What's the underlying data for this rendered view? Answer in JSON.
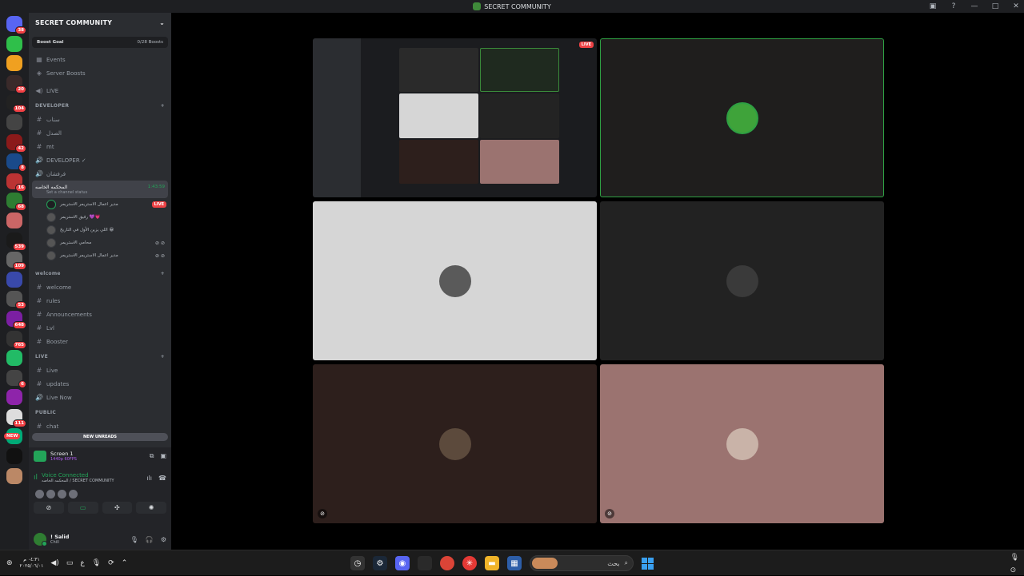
{
  "window": {
    "title": "SECRET COMMUNITY"
  },
  "servers": {
    "badges": [
      "38",
      "",
      "",
      "20",
      "104",
      "",
      "42",
      "8",
      "16",
      "68",
      "",
      "539",
      "109",
      "",
      "53",
      "648",
      "765",
      "",
      "6",
      "",
      "111",
      "",
      "",
      ""
    ],
    "new_label": "NEW"
  },
  "guild": {
    "name": "SECRET COMMUNITY",
    "boost_label": "Boost Goal",
    "boost_count": "0/28 Boosts",
    "events": "Events",
    "server_boosts": "Server Boosts",
    "live": "LIVE"
  },
  "categories": {
    "developer": "DEVELOPER",
    "welcome": "welcome",
    "live": "LIVE",
    "public": "PUBLIC"
  },
  "channels_dev": [
    {
      "icon": "#",
      "label": "سناب"
    },
    {
      "icon": "#",
      "label": "الصدل"
    },
    {
      "icon": "#",
      "label": "mt"
    },
    {
      "icon": "🔊",
      "label": "DEVELOPER ✓"
    },
    {
      "icon": "🔊",
      "label": "فرفشان"
    }
  ],
  "active_voice": {
    "label": "المحكمه الخاصه",
    "timer": "1:43:59",
    "status": "Set a channel status"
  },
  "voice_users": [
    {
      "name": "مدير اعمال الاستريمر الاستريمر",
      "live": "LIVE"
    },
    {
      "name": "رفيق الاستريمر 💜💗",
      "live": ""
    },
    {
      "name": "اللي يزين الأول في التاريخ 😁",
      "live": ""
    },
    {
      "name": "محامي الاستريمر",
      "live": ""
    },
    {
      "name": "مدير اعمال الاستريمر الاستريمر",
      "live": ""
    }
  ],
  "channels_welcome": [
    {
      "icon": "#",
      "label": "welcome"
    },
    {
      "icon": "#",
      "label": "rules"
    },
    {
      "icon": "#",
      "label": "Announcements"
    },
    {
      "icon": "#",
      "label": "Lvl"
    },
    {
      "icon": "#",
      "label": "Booster"
    }
  ],
  "channels_live": [
    {
      "icon": "#",
      "label": "Live"
    },
    {
      "icon": "#",
      "label": "updates"
    },
    {
      "icon": "🔊",
      "label": "Live Now"
    }
  ],
  "last_channel": "chat",
  "new_unreads": "NEW UNREADS",
  "panel": {
    "screen_title": "Screen 1",
    "screen_quality": "1440p 60FPS",
    "voice_title": "Voice Connected",
    "voice_sub": "المحكمه الخاصه / SECRET COMMUNITY",
    "user_name": "! Salid",
    "user_status": "Chill"
  },
  "stage": {
    "live_badge": "LIVE"
  },
  "taskbar": {
    "time": "٠٤:٣١ م",
    "date": "٢٠٢٥/٠٦/٠١",
    "lang": "ع",
    "search_placeholder": "بحث"
  },
  "colors": {
    "accent_green": "#23a559",
    "live_red": "#ed4245",
    "tile_light": "#d6d6d6",
    "tile_dark": "#222222",
    "tile_brown": "#2d1f1c",
    "tile_pink": "#9b7370"
  }
}
